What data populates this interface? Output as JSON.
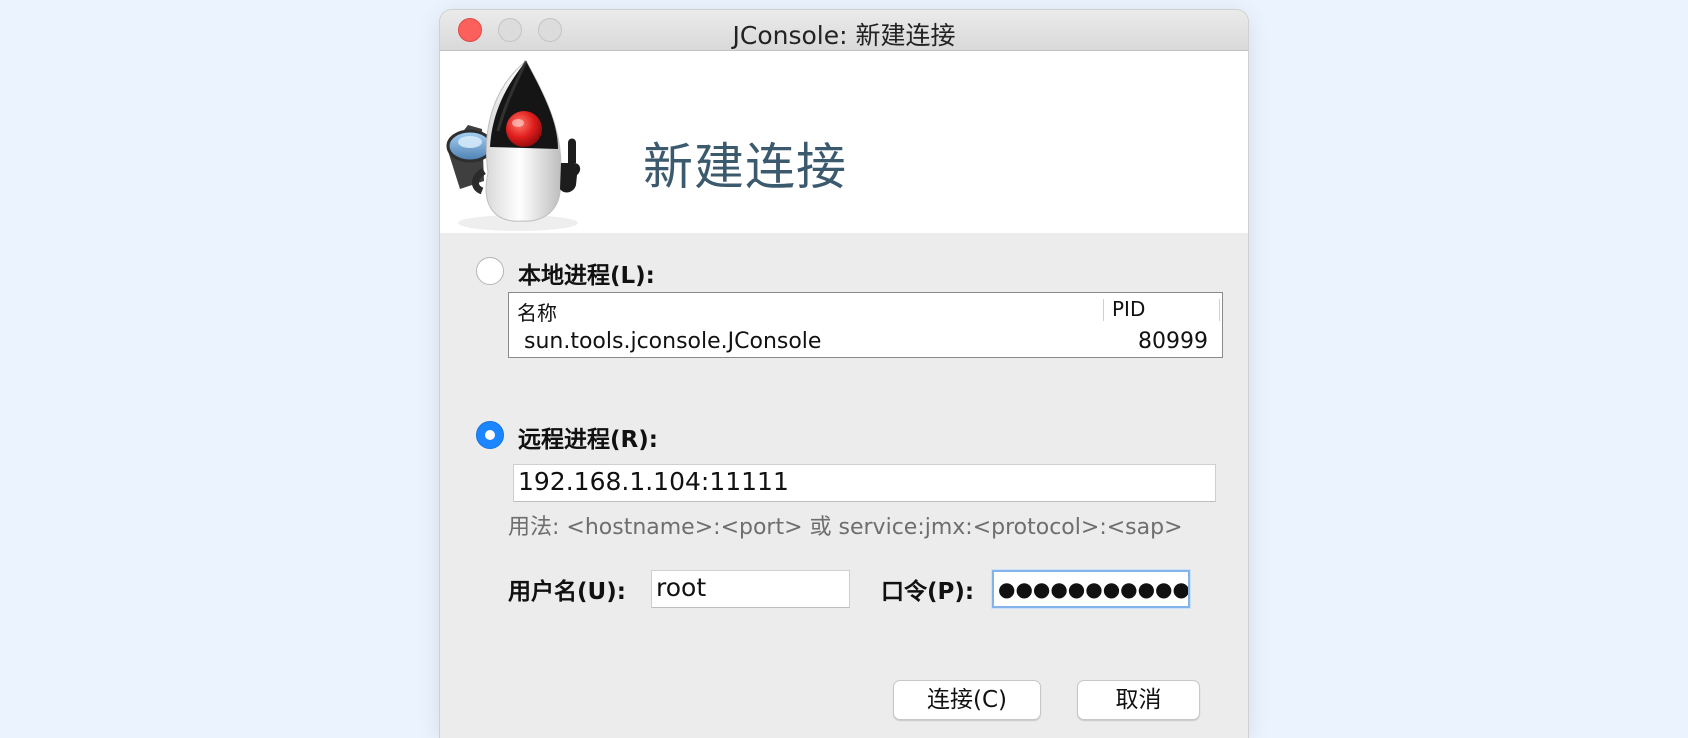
{
  "window": {
    "title": "JConsole: 新建连接"
  },
  "banner": {
    "heading": "新建连接",
    "logo_icon": "java-duke-mascot-icon"
  },
  "local": {
    "radio_label": "本地进程(L):",
    "selected": false,
    "columns": [
      "名称",
      "PID"
    ],
    "rows": [
      {
        "name": "sun.tools.jconsole.JConsole",
        "pid": "80999"
      }
    ]
  },
  "remote": {
    "radio_label": "远程进程(R):",
    "selected": true,
    "address_value": "192.168.1.104:11111",
    "usage_hint": "用法: <hostname>:<port> 或 service:jmx:<protocol>:<sap>"
  },
  "credentials": {
    "username_label": "用户名(U):",
    "username_value": "root",
    "password_label": "口令(P):",
    "password_mask": "●●●●●●●●●●●●"
  },
  "buttons": {
    "connect": "连接(C)",
    "cancel": "取消"
  },
  "colors": {
    "accent": "#1b86ff",
    "banner_title": "#3b5a6e",
    "close_button": "#fc605c",
    "desktop_background": "#eaf3fe"
  }
}
